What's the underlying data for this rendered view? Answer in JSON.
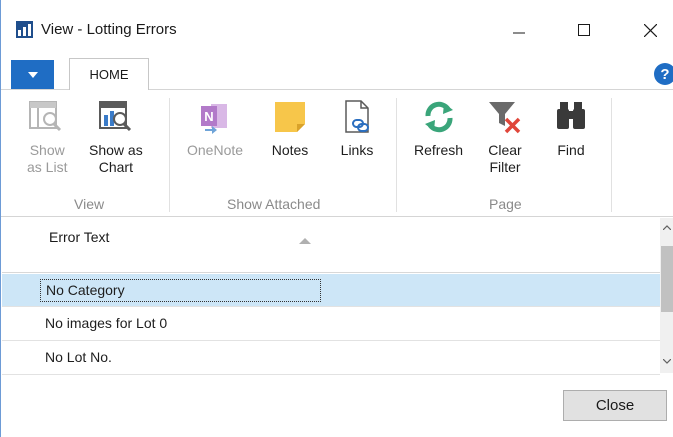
{
  "window": {
    "title": "View - Lotting Errors"
  },
  "tabs": {
    "home": "HOME"
  },
  "ribbon": {
    "show_as_list": "Show\nas List",
    "show_as_chart": "Show as\nChart",
    "onenote": "OneNote",
    "notes": "Notes",
    "links": "Links",
    "refresh": "Refresh",
    "clear_filter": "Clear\nFilter",
    "find": "Find",
    "groups": {
      "view": "View",
      "show_attached": "Show Attached",
      "page": "Page"
    }
  },
  "list": {
    "column_header": "Error Text",
    "rows": [
      "No Category",
      "No images for Lot 0",
      "No Lot No."
    ],
    "selected_index": 0
  },
  "footer": {
    "close": "Close"
  },
  "colors": {
    "accent": "#1f6dc4",
    "selection": "#cde6f7",
    "refresh_green": "#3aa57a",
    "clear_red": "#e0463a",
    "notes_yellow": "#f7c64a",
    "onenote_purple": "#b27ac9"
  }
}
